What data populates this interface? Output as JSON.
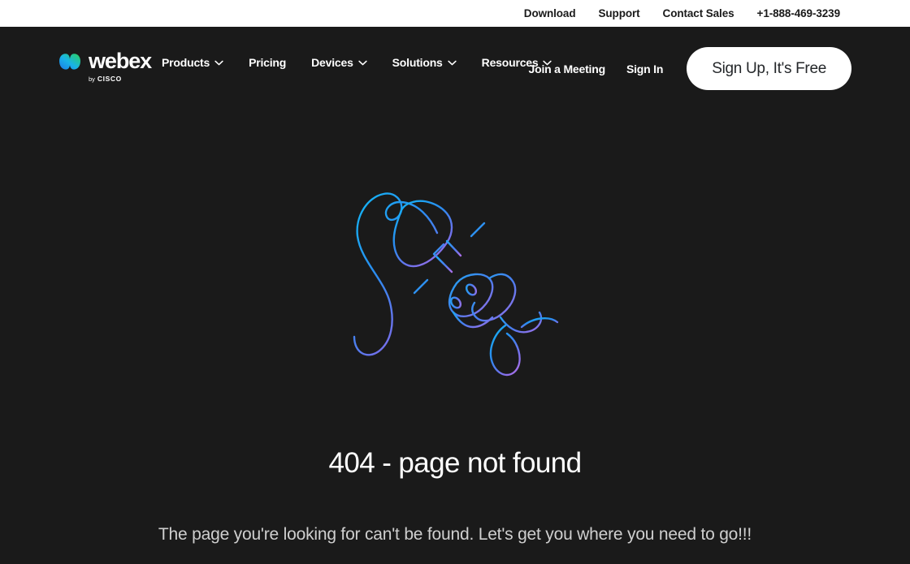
{
  "utility_bar": {
    "links": [
      {
        "label": "Download",
        "name": "download"
      },
      {
        "label": "Support",
        "name": "support"
      },
      {
        "label": "Contact Sales",
        "name": "contact-sales"
      },
      {
        "label": "+1-888-469-3239",
        "name": "phone"
      }
    ]
  },
  "header": {
    "brand": {
      "word": "webex",
      "by": "by",
      "cisco": "CISCO",
      "logo_icon": "webex-logo-icon",
      "gradient_start": "#1BB6FF",
      "gradient_end": "#29D05B"
    },
    "nav": [
      {
        "label": "Products",
        "has_chevron": true,
        "name": "products"
      },
      {
        "label": "Pricing",
        "has_chevron": false,
        "name": "pricing"
      },
      {
        "label": "Devices",
        "has_chevron": true,
        "name": "devices"
      },
      {
        "label": "Solutions",
        "has_chevron": true,
        "name": "solutions"
      },
      {
        "label": "Resources",
        "has_chevron": true,
        "name": "resources"
      }
    ],
    "join_meeting": "Join a Meeting",
    "sign_in": "Sign In",
    "sign_up": "Sign Up, It's Free"
  },
  "error": {
    "illustration_icon": "unplugged-plug-socket-illustration",
    "title": "404 - page not found",
    "subtitle": "The page you're looking for can't be found. Let's get you where you need to go!!!"
  },
  "colors": {
    "page_background": "#1a1a1a",
    "utility_background": "#ffffff",
    "text_light": "#ffffff",
    "text_muted": "#cfcfcf",
    "illustration_cyan": "#21A7F2",
    "illustration_blue": "#3B7BEE",
    "illustration_purple": "#9B6CE8"
  }
}
